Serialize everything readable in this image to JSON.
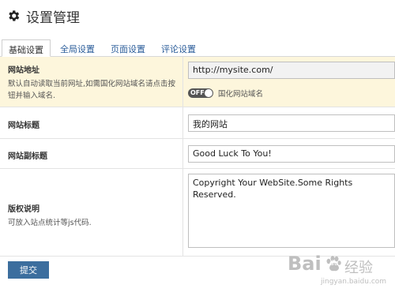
{
  "header": {
    "title": "设置管理",
    "icon": "gear-icon"
  },
  "tabs": [
    {
      "label": "基础设置",
      "active": true
    },
    {
      "label": "全局设置",
      "active": false
    },
    {
      "label": "页面设置",
      "active": false
    },
    {
      "label": "评论设置",
      "active": false
    }
  ],
  "form": {
    "site_url": {
      "label": "网站地址",
      "description": "默认自动读取当前网址,如需国化网站域名请点击按钮并输入域名.",
      "value": "http://mysite.com/",
      "toggle_state": "OFF",
      "toggle_label": "国化网站域名"
    },
    "site_title": {
      "label": "网站标题",
      "value": "我的网站"
    },
    "site_subtitle": {
      "label": "网站副标题",
      "value": "Good Luck To You!"
    },
    "copyright": {
      "label": "版权说明",
      "description": "可放入站点统计等js代码.",
      "value": "Copyright Your WebSite.Some Rights Reserved."
    }
  },
  "submit_label": "提交",
  "watermark": {
    "brand": "Bai",
    "paw": "du",
    "suffix": "经验",
    "url": "jingyan.baidu.com"
  },
  "colors": {
    "accent": "#3c6e9e",
    "highlight_row": "#fdf6dc",
    "tab_link": "#2b5d9a",
    "toggle_bg": "#555555"
  }
}
